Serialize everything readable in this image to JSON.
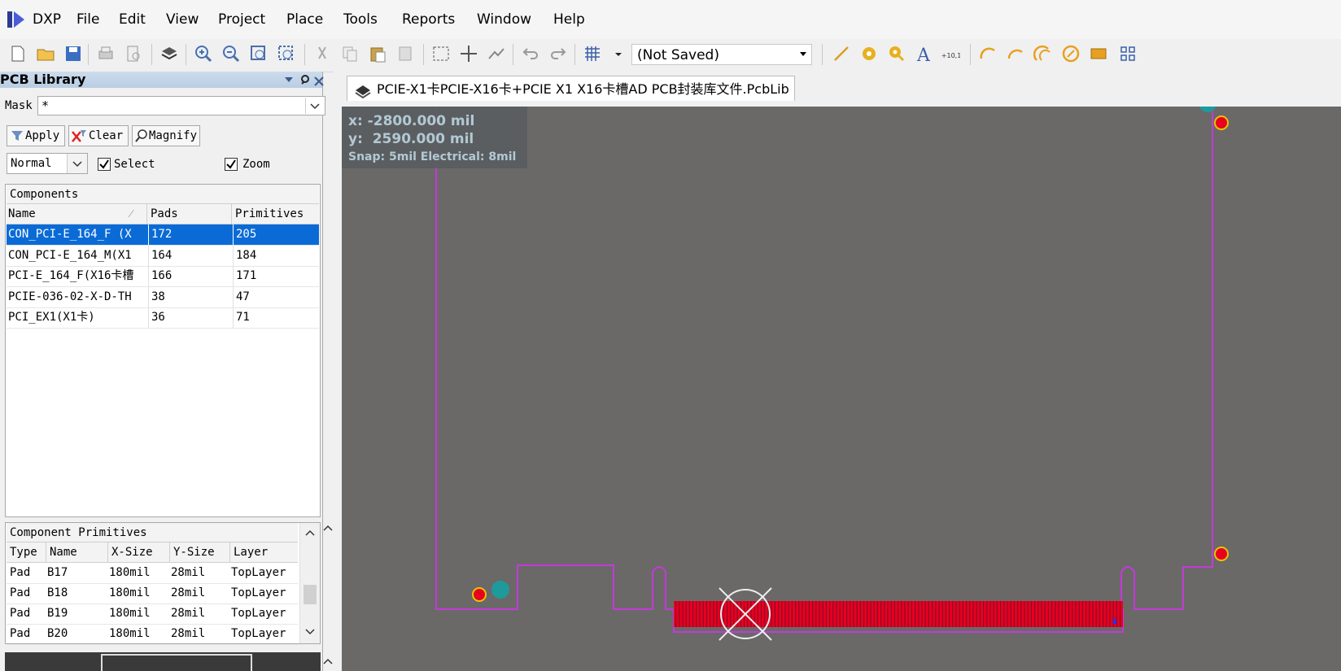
{
  "app": {
    "logo_text": "DXP"
  },
  "menu": [
    {
      "label": "File"
    },
    {
      "label": "Edit"
    },
    {
      "label": "View"
    },
    {
      "label": "Project"
    },
    {
      "label": "Place"
    },
    {
      "label": "Tools"
    },
    {
      "label": "Reports"
    },
    {
      "label": "Window"
    },
    {
      "label": "Help"
    }
  ],
  "toolbar": {
    "save_state": "(Not Saved)"
  },
  "panel": {
    "title": "PCB Library",
    "mask_label": "Mask",
    "mask_value": "*",
    "apply_label": "Apply",
    "clear_label": "Clear",
    "magnify_label": "Magnify",
    "mode_value": "Normal",
    "select_label": "Select",
    "zoom_label": "Zoom",
    "select_checked": true,
    "zoom_checked": true
  },
  "components": {
    "title": "Components",
    "columns": [
      "Name",
      "Pads",
      "Primitives"
    ],
    "rows": [
      {
        "name": "CON_PCI-E_164_F (X",
        "pads": "172",
        "primitives": "205",
        "selected": true
      },
      {
        "name": "CON_PCI-E_164_M(X1",
        "pads": "164",
        "primitives": "184",
        "selected": false
      },
      {
        "name": "PCI-E_164_F(X16卡槽",
        "pads": "166",
        "primitives": "171",
        "selected": false
      },
      {
        "name": "PCIE-036-02-X-D-TH",
        "pads": "38",
        "primitives": "47",
        "selected": false
      },
      {
        "name": "PCI_EX1(X1卡)",
        "pads": "36",
        "primitives": "71",
        "selected": false
      }
    ]
  },
  "primitives": {
    "title": "Component Primitives",
    "columns": [
      "Type",
      "Name",
      "X-Size",
      "Y-Size",
      "Layer"
    ],
    "rows": [
      [
        "Pad",
        "B17",
        "180mil",
        "28mil",
        "TopLayer"
      ],
      [
        "Pad",
        "B18",
        "180mil",
        "28mil",
        "TopLayer"
      ],
      [
        "Pad",
        "B19",
        "180mil",
        "28mil",
        "TopLayer"
      ],
      [
        "Pad",
        "B20",
        "180mil",
        "28mil",
        "TopLayer"
      ]
    ]
  },
  "document": {
    "tab_label": "PCIE-X1卡PCIE-X16卡+PCIE X1 X16卡槽AD PCB封装库文件.PcbLib"
  },
  "hud": {
    "x_line": "x: -2800.000 mil",
    "y_line": "y:  2590.000 mil",
    "snap_line": "Snap: 5mil Electrical: 8mil"
  },
  "colors": {
    "canvas_bg": "#6b6868",
    "outline": "#c33ad9",
    "pad_red": "#e8001f",
    "pad_teal": "#1f9a9a",
    "selection_blue": "#0a6bd6"
  }
}
